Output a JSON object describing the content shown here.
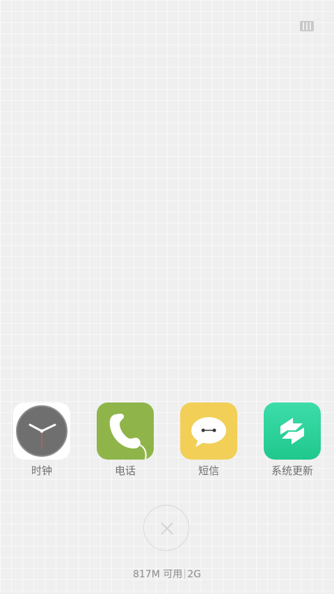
{
  "icons": {
    "layout_toggle": "grid-layout-icon",
    "close": "close-icon"
  },
  "dock": {
    "apps": [
      {
        "label": "时钟",
        "icon": "clock-icon",
        "color": "#7a7a7a"
      },
      {
        "label": "电话",
        "icon": "phone-icon",
        "color": "#8fb54a"
      },
      {
        "label": "短信",
        "icon": "message-icon",
        "color": "#f2cf57"
      },
      {
        "label": "系统更新",
        "icon": "system-update-icon",
        "color": "#2ed39b"
      }
    ]
  },
  "memory": {
    "available": "817M 可用",
    "total": "2G"
  }
}
